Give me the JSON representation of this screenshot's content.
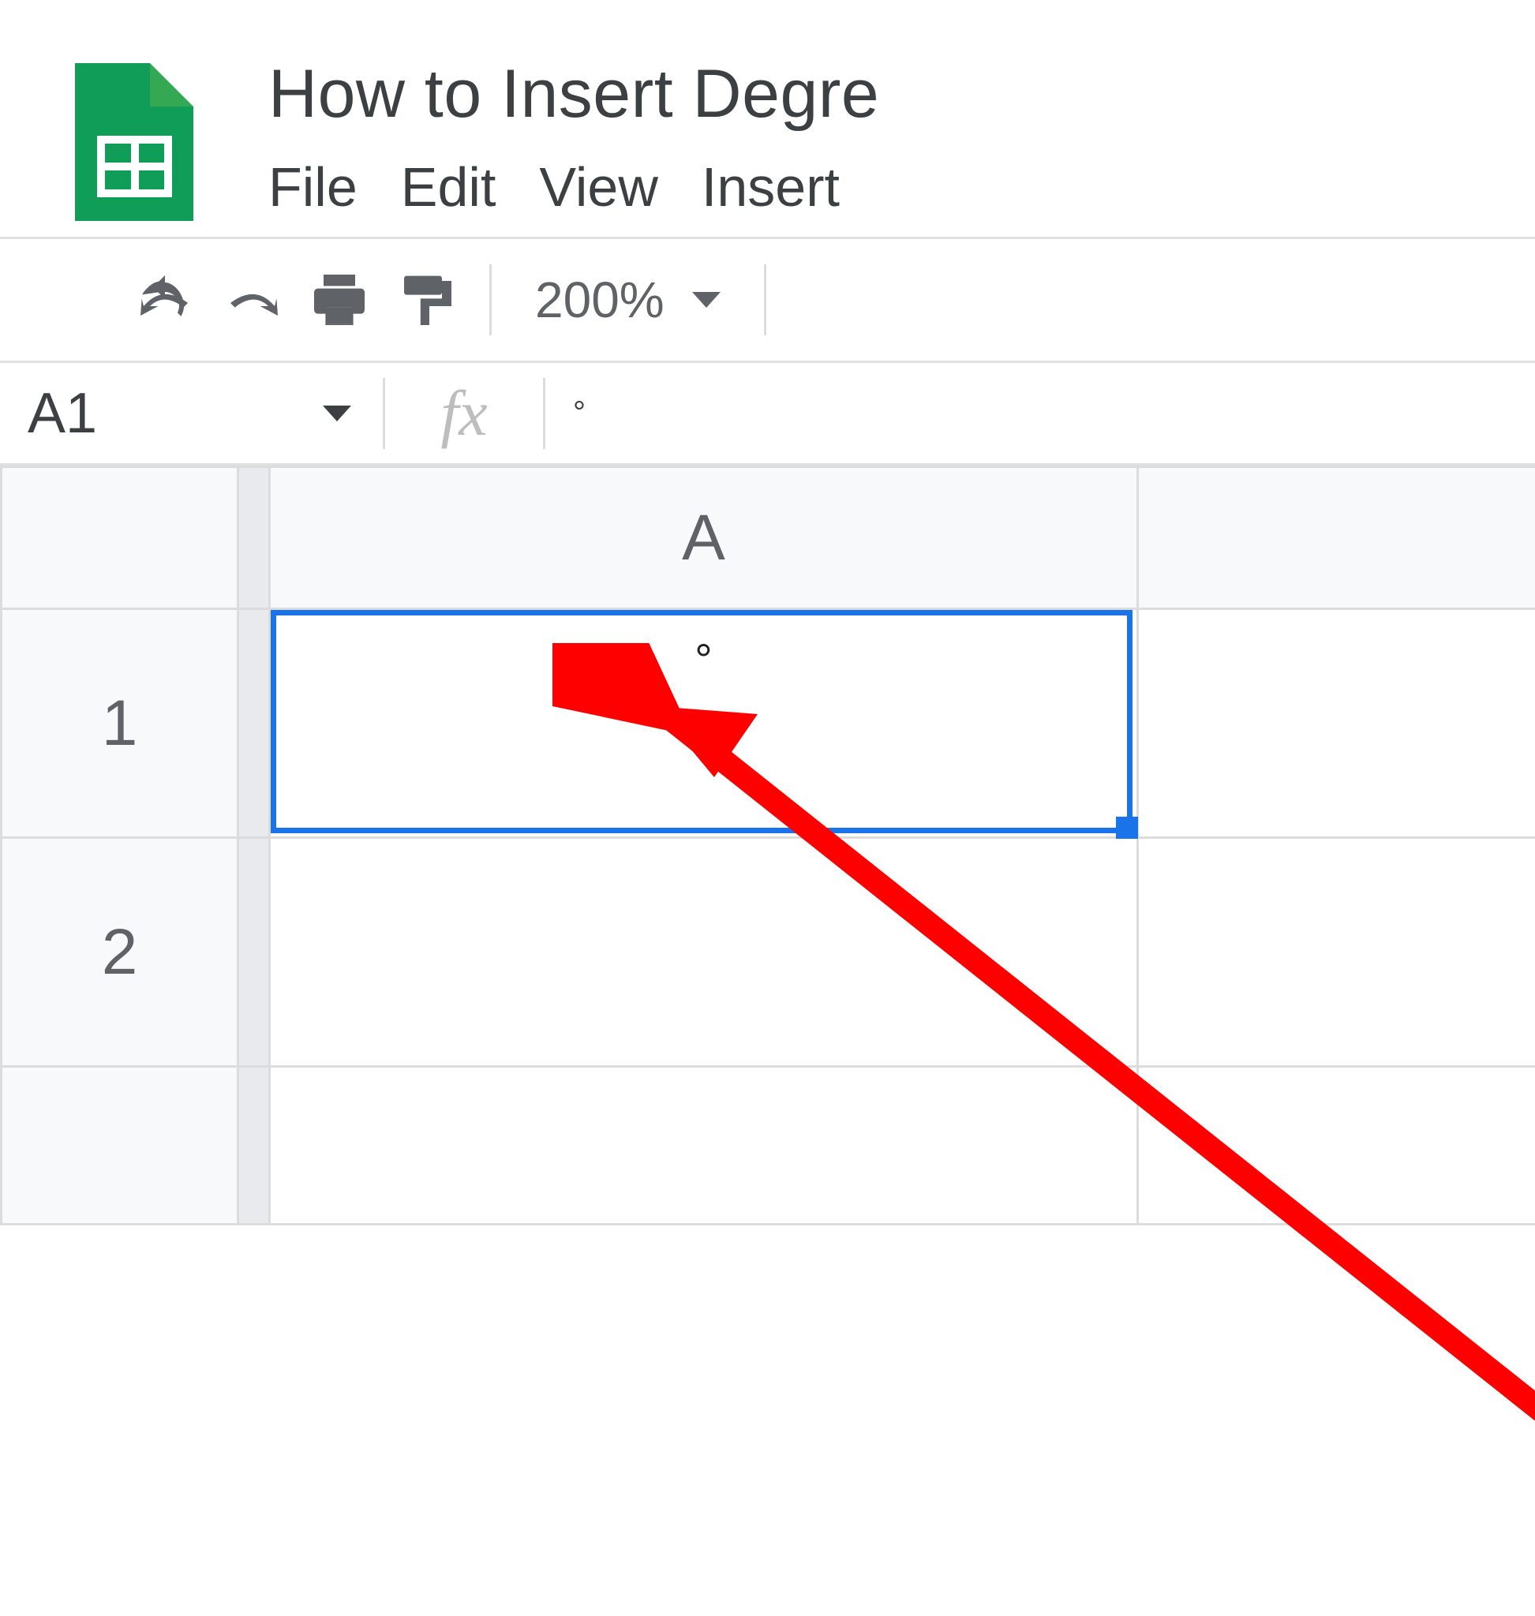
{
  "header": {
    "doc_title": "How to Insert Degre"
  },
  "menubar": {
    "items": [
      "File",
      "Edit",
      "View",
      "Insert"
    ]
  },
  "toolbar": {
    "zoom_label": "200%"
  },
  "formula_bar": {
    "name_box": "A1",
    "fx_label": "fx",
    "formula_value": "°"
  },
  "grid": {
    "column_headers": [
      "A"
    ],
    "row_headers": [
      "1",
      "2"
    ],
    "cells": {
      "A1": "°",
      "A2": ""
    },
    "selected_cell": "A1"
  },
  "colors": {
    "brand_green": "#0f9d58",
    "selection_blue": "#1a73e8",
    "annotation_red": "#ff0000"
  }
}
